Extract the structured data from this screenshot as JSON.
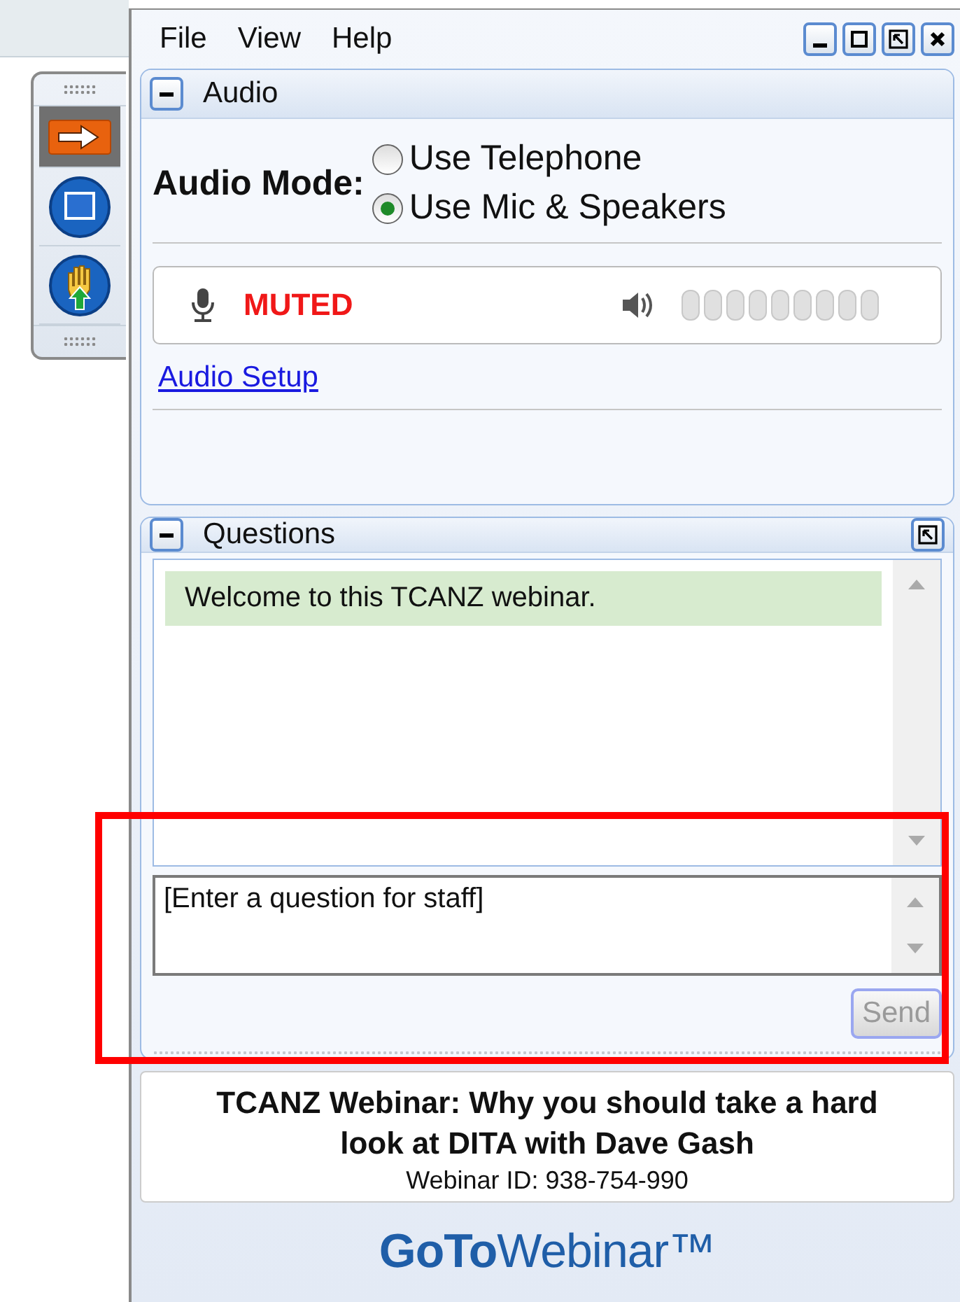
{
  "menu": [
    "File",
    "View",
    "Help"
  ],
  "toolbar": [
    {
      "kind": "arrow",
      "selected": true
    },
    {
      "kind": "screen",
      "selected": false
    },
    {
      "kind": "hand",
      "selected": false
    }
  ],
  "audio": {
    "title": "Audio",
    "expanded": true,
    "mode_label": "Audio Mode:",
    "options": [
      {
        "label": "Use Telephone",
        "selected": false
      },
      {
        "label": "Use Mic & Speakers",
        "selected": true
      }
    ],
    "mic_status": "MUTED",
    "setup_link": "Audio Setup"
  },
  "questions": {
    "title": "Questions",
    "expanded": true,
    "messages": [
      "Welcome to this TCANZ webinar."
    ],
    "input": {
      "placeholder": "[Enter a question for staff]"
    },
    "send": {
      "label": "Send",
      "disabled": true
    }
  },
  "info": {
    "title": "TCANZ Webinar: Why you should take a hard look at DITA with Dave Gash",
    "id_line": "Webinar ID: 938-754-990"
  },
  "brand": "**GoTo**Webinar™"
}
